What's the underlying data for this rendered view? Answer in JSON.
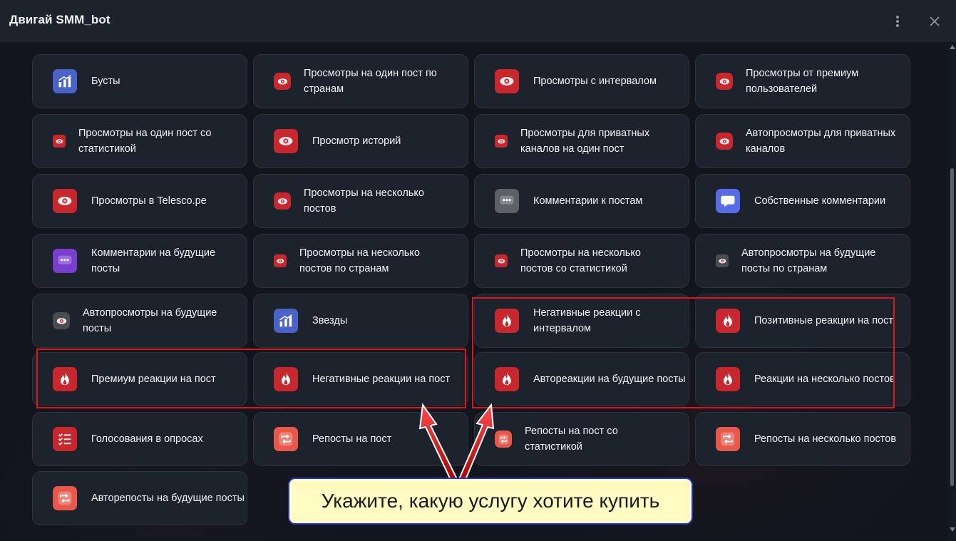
{
  "window": {
    "title": "Двигай SMM_bot",
    "menu_icon": "kebab-menu-icon",
    "close_icon": "close-icon"
  },
  "services": [
    {
      "id": "boosts",
      "label": "Бусты",
      "icon": "chart-boost-icon"
    },
    {
      "id": "views-country",
      "label": "Просмотры на один пост по странам",
      "icon": "eye-icon"
    },
    {
      "id": "views-interval",
      "label": "Просмотры с интервалом",
      "icon": "eye-icon"
    },
    {
      "id": "views-premium",
      "label": "Просмотры от премиум пользователей",
      "icon": "eye-icon"
    },
    {
      "id": "views-stats",
      "label": "Просмотры на один пост со статистикой",
      "icon": "eye-icon"
    },
    {
      "id": "story-views",
      "label": "Просмотр историй",
      "icon": "eye-icon"
    },
    {
      "id": "private-views",
      "label": "Просмотры для приватных каналов на один пост",
      "icon": "eye-icon"
    },
    {
      "id": "private-autoviews",
      "label": "Автопросмотры для приватных каналов",
      "icon": "eye-icon"
    },
    {
      "id": "telesco-views",
      "label": "Просмотры в Telesco.pe",
      "icon": "eye-icon"
    },
    {
      "id": "multi-views",
      "label": "Просмотры на несколько постов",
      "icon": "eye-icon"
    },
    {
      "id": "comments",
      "label": "Комментарии к постам",
      "icon": "comment-icon"
    },
    {
      "id": "own-comments",
      "label": "Собственные комментарии",
      "icon": "comment-bubble-icon"
    },
    {
      "id": "future-comments",
      "label": "Комментарии на будущие посты",
      "icon": "auto-comment-icon"
    },
    {
      "id": "multi-views-country",
      "label": "Просмотры на несколько постов по странам",
      "icon": "eye-icon"
    },
    {
      "id": "multi-views-stats",
      "label": "Просмотры на несколько постов со статистикой",
      "icon": "eye-icon"
    },
    {
      "id": "autoviews-country",
      "label": "Автопросмотры на будущие посты по странам",
      "icon": "auto-eye-icon"
    },
    {
      "id": "autoviews",
      "label": "Автопросмотры на будущие посты",
      "icon": "auto-eye-icon"
    },
    {
      "id": "stars",
      "label": "Звезды",
      "icon": "chart-star-icon"
    },
    {
      "id": "neg-reactions-interval",
      "label": "Негативные реакции с интервалом",
      "icon": "reaction-flame-icon"
    },
    {
      "id": "pos-reactions",
      "label": "Позитивные реакции на пост",
      "icon": "reaction-flame-icon"
    },
    {
      "id": "premium-reactions",
      "label": "Премиум реакции на пост",
      "icon": "reaction-flame-icon"
    },
    {
      "id": "neg-reactions",
      "label": "Негативные реакции на пост",
      "icon": "reaction-flame-icon"
    },
    {
      "id": "auto-reactions",
      "label": "Автореакции на будущие посты",
      "icon": "auto-reaction-icon"
    },
    {
      "id": "multi-reactions",
      "label": "Реакции на несколько постов",
      "icon": "reaction-flame-icon"
    },
    {
      "id": "polls",
      "label": "Голосования в опросах",
      "icon": "poll-list-icon"
    },
    {
      "id": "reposts",
      "label": "Репосты на пост",
      "icon": "repost-icon"
    },
    {
      "id": "reposts-stats",
      "label": "Репосты на пост со статистикой",
      "icon": "repost-icon"
    },
    {
      "id": "multi-reposts",
      "label": "Репосты на несколько постов",
      "icon": "repost-icon"
    },
    {
      "id": "auto-reposts",
      "label": "Авторепосты на будущие посты",
      "icon": "auto-repost-icon"
    }
  ],
  "callout": {
    "text": "Укажите, какую услугу хотите купить"
  },
  "colors": {
    "highlight": "#e0141a",
    "callout_bg": "#fdfbc2",
    "callout_border": "#2a3aa8",
    "card_bg": "#1c232c",
    "icon_red": "#c8282d",
    "icon_blue": "#4a63c8"
  }
}
